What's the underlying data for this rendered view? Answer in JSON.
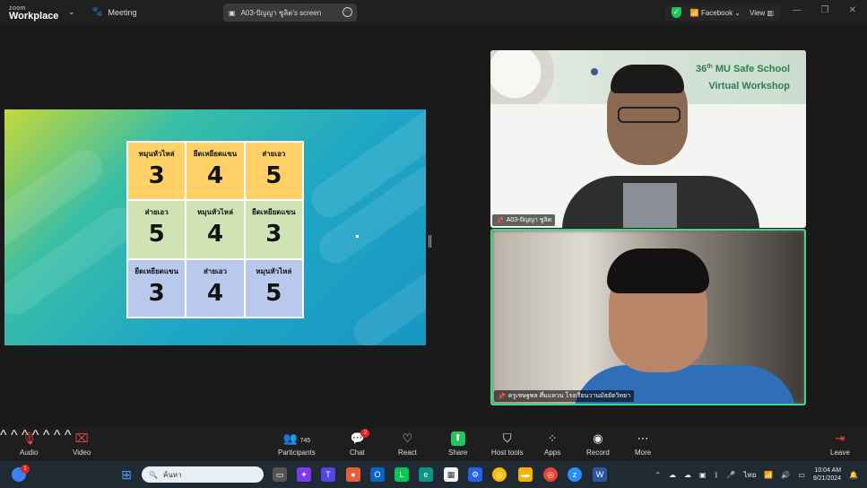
{
  "titlebar": {
    "logo_line1": "zoom",
    "logo_line2": "Workplace",
    "meeting_label": "Meeting",
    "screen_label": "A03-ปัญญา ชูลิต's screen",
    "view_source": "Facebook",
    "view_label": "View"
  },
  "slide": {
    "grid": [
      [
        {
          "label": "หมุนหัวไหล่",
          "num": "3"
        },
        {
          "label": "ยืดเหยียดแขน",
          "num": "4"
        },
        {
          "label": "ส่ายเอว",
          "num": "5"
        }
      ],
      [
        {
          "label": "ส่ายเอว",
          "num": "5"
        },
        {
          "label": "หมุนหัวไหล่",
          "num": "4"
        },
        {
          "label": "ยืดเหยียดแขน",
          "num": "3"
        }
      ],
      [
        {
          "label": "ยืดเหยียดแขน",
          "num": "3"
        },
        {
          "label": "ส่ายเอว",
          "num": "4"
        },
        {
          "label": "หมุนหัวไหล่",
          "num": "5"
        }
      ]
    ],
    "row_colors": [
      "#ffd166",
      "#cfe3b5",
      "#b9c9ec"
    ]
  },
  "tiles": {
    "tile1": {
      "banner_num": "36",
      "banner_sup": "th",
      "banner_line1": "MU Safe School",
      "banner_line2": "Virtual Workshop",
      "name": "A03-ปัญญา ชูลิต"
    },
    "tile2": {
      "name": "ครูเชษฐพล ศึ่มแหวน โรงเรียนวานมัธยัตวิทยา"
    }
  },
  "toolbar": {
    "audio": "Audio",
    "video": "Video",
    "participants": "Participants",
    "participants_count": "745",
    "chat": "Chat",
    "chat_badge": "2",
    "react": "React",
    "share": "Share",
    "host_tools": "Host tools",
    "apps": "Apps",
    "record": "Record",
    "more": "More",
    "leave": "Leave"
  },
  "taskbar": {
    "search_placeholder": "ค้นหา",
    "lang": "ไทย",
    "time": "10:04 AM",
    "date": "9/21/2024",
    "notif_badge": "1"
  },
  "icons": {
    "audio": "mic-muted-icon",
    "video": "camera-off-icon",
    "participants": "people-icon",
    "chat": "chat-bubble-icon",
    "react": "heart-icon",
    "share": "share-up-arrow-icon",
    "host_tools": "shield-icon",
    "apps": "apps-icon",
    "record": "record-icon",
    "more": "ellipsis-icon",
    "leave": "door-exit-icon"
  }
}
